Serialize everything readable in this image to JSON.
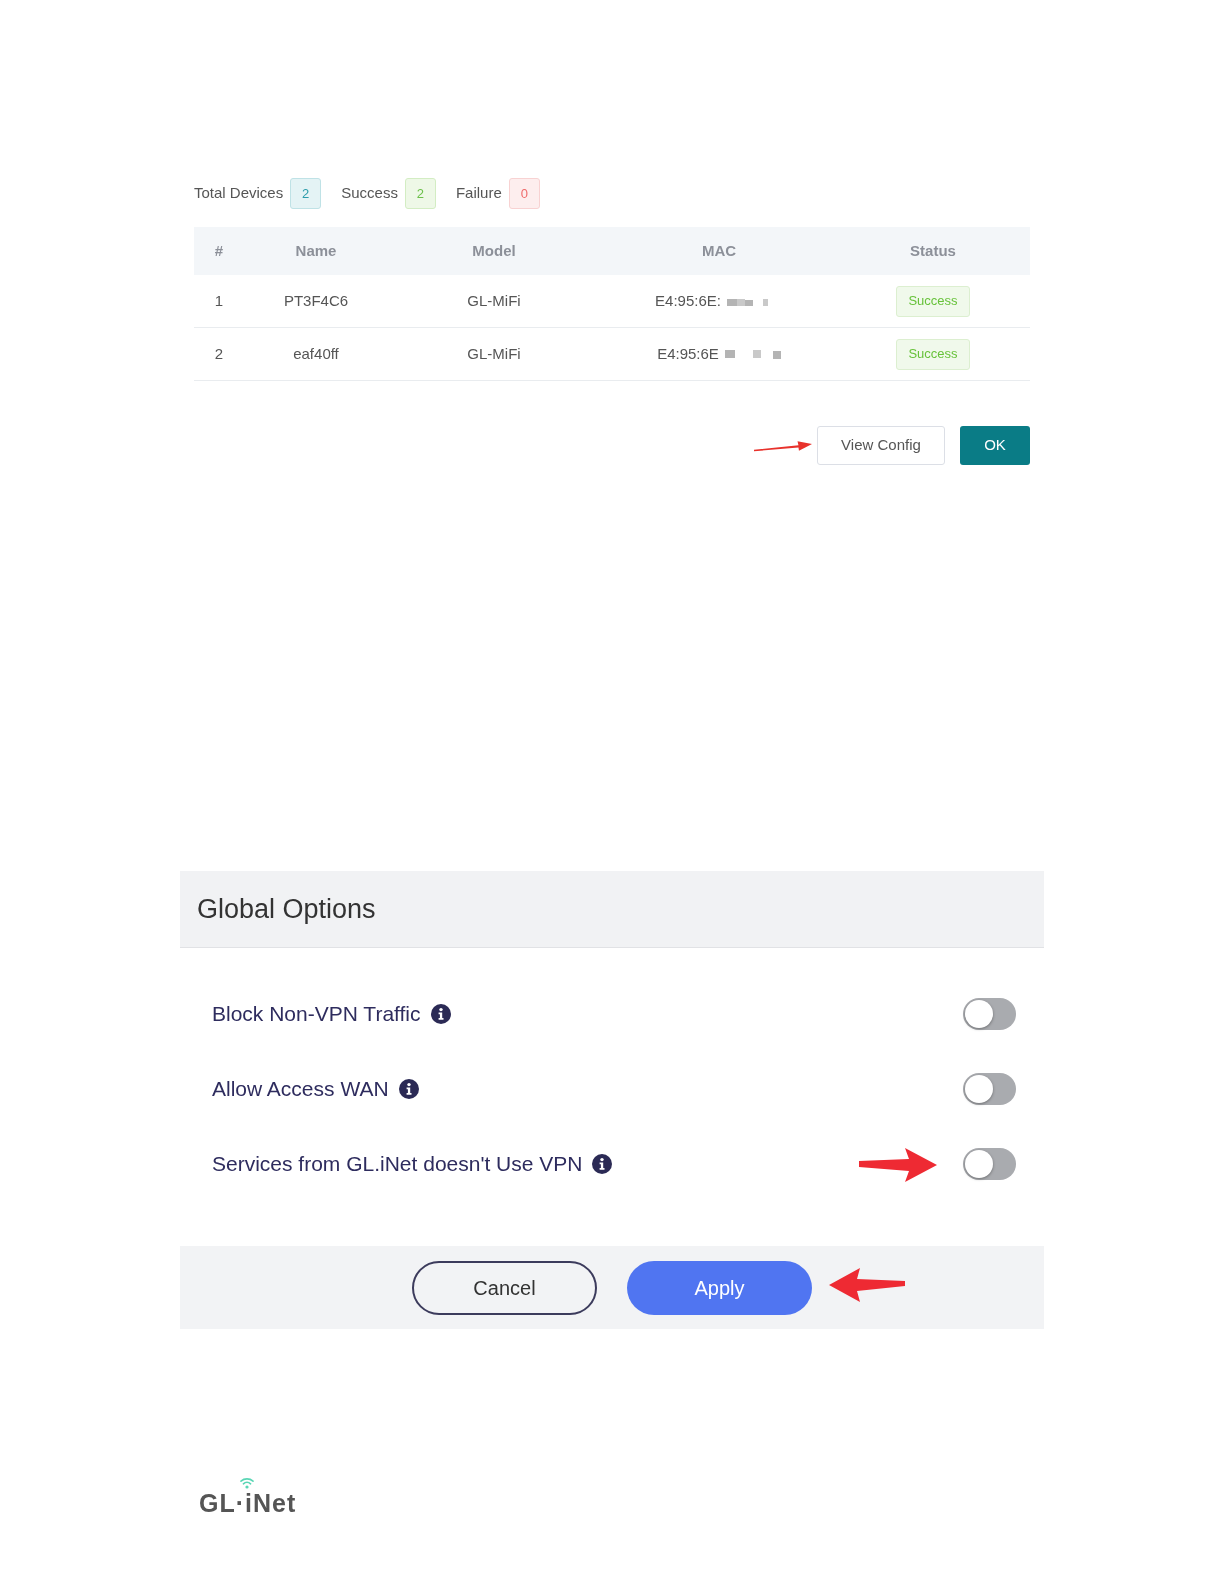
{
  "summary": [
    {
      "label": "Total Devices",
      "count": "2",
      "kind": "total"
    },
    {
      "label": "Success",
      "count": "2",
      "kind": "success"
    },
    {
      "label": "Failure",
      "count": "0",
      "kind": "failure"
    }
  ],
  "table": {
    "columns": [
      "#",
      "Name",
      "Model",
      "MAC",
      "Status"
    ],
    "rows": [
      {
        "index": "1",
        "name": "PT3F4C6",
        "model": "GL-MiFi",
        "mac": "E4:95:6E:",
        "status": "Success"
      },
      {
        "index": "2",
        "name": "eaf40ff",
        "model": "GL-MiFi",
        "mac": "E4:95:6E",
        "status": "Success"
      }
    ]
  },
  "actions": [
    {
      "label": "View Config",
      "kind": "secondary"
    },
    {
      "label": "OK",
      "kind": "primary"
    }
  ],
  "global_options": {
    "title": "Global Options",
    "options": [
      {
        "label": "Block Non-VPN Traffic",
        "on": false
      },
      {
        "label": "Allow Access WAN",
        "on": false
      },
      {
        "label": "Services from GL.iNet doesn't Use VPN",
        "on": false
      }
    ],
    "buttons": [
      {
        "label": "Cancel",
        "kind": "secondary"
      },
      {
        "label": "Apply",
        "kind": "primary"
      }
    ]
  },
  "logo": {
    "text": "GL·iNet"
  }
}
